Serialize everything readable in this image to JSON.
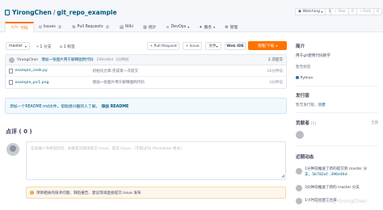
{
  "repo": {
    "owner": "YirongChen",
    "name": "git_repo_example"
  },
  "header_stats": {
    "watching_label": "Watching",
    "watching_count": "1",
    "star_label": "Star",
    "star_count": "0",
    "fork_label": "Fork",
    "fork_count": "0"
  },
  "tabs": [
    {
      "label": "代码",
      "icon": "code-icon"
    },
    {
      "label": "Issues",
      "badge": "0",
      "icon": "issue-icon"
    },
    {
      "label": "Pull Requests",
      "badge": "0",
      "icon": "pr-icon"
    },
    {
      "label": "Wiki",
      "icon": "wiki-icon"
    },
    {
      "label": "统计",
      "icon": "stats-icon"
    },
    {
      "label": "DevOps",
      "icon": "devops-icon"
    },
    {
      "label": "服务",
      "icon": "service-icon"
    },
    {
      "label": "管理",
      "icon": "settings-icon"
    }
  ],
  "toolbar": {
    "branch": "master",
    "branches": "1 分支",
    "tags": "1 标签",
    "pull_request": "+ Pull Request",
    "issue": "+ Issue",
    "file": "文件",
    "web_ide": "Web IDE",
    "clone": "克隆/下载"
  },
  "commit": {
    "author": "YirongChen",
    "message": "增加一张图片用于解释图例代码",
    "hash": "296e46d",
    "time": "3分钟前",
    "count": "2 次提交"
  },
  "files": [
    {
      "name": "example_code.py",
      "message": "初始化仓库,完成第一次提交",
      "time": "16分钟前"
    },
    {
      "name": "example_pic1.png",
      "message": "增加一张图片用于解释图例代码",
      "time": "3分钟前"
    }
  ],
  "readme": {
    "text": "添加一个README.md文件，帮助感兴趣的人了解，",
    "link": "添加 README"
  },
  "comments": {
    "title": "点评 ( 0 )",
    "placeholder": "在此输入你想说的话，如果是问题请提交 Issue，提及 Issue。（不超过5k Markdown 格式）",
    "hint": "项目相关的技术问题、缺陷报告、建议等请直接提交 Issue 发布"
  },
  "sidebar": {
    "intro_title": "简介",
    "intro_text": "用于git使用代码教学",
    "no_tags": "暂无标签",
    "language": "Python",
    "release_title": "发行版",
    "release_text": "暂无发行版，",
    "release_link": "创建",
    "contributors_title": "贡献者",
    "contributors_count": "(1)",
    "contributors_all": "全部",
    "activity_title": "近期动态",
    "activities": [
      {
        "line1": "1分钟前推送了新的提交到 master 分",
        "line2": "支，5b782af...396e46d"
      },
      {
        "line1": "3分钟前推送了新的 master 分支"
      },
      {
        "line1": "1小时前创建了仓库"
      }
    ]
  },
  "watermark": "CSDN @YirongChen",
  "colors": {
    "accent": "#fe7300",
    "link": "#005980",
    "python": "#3572a5"
  }
}
